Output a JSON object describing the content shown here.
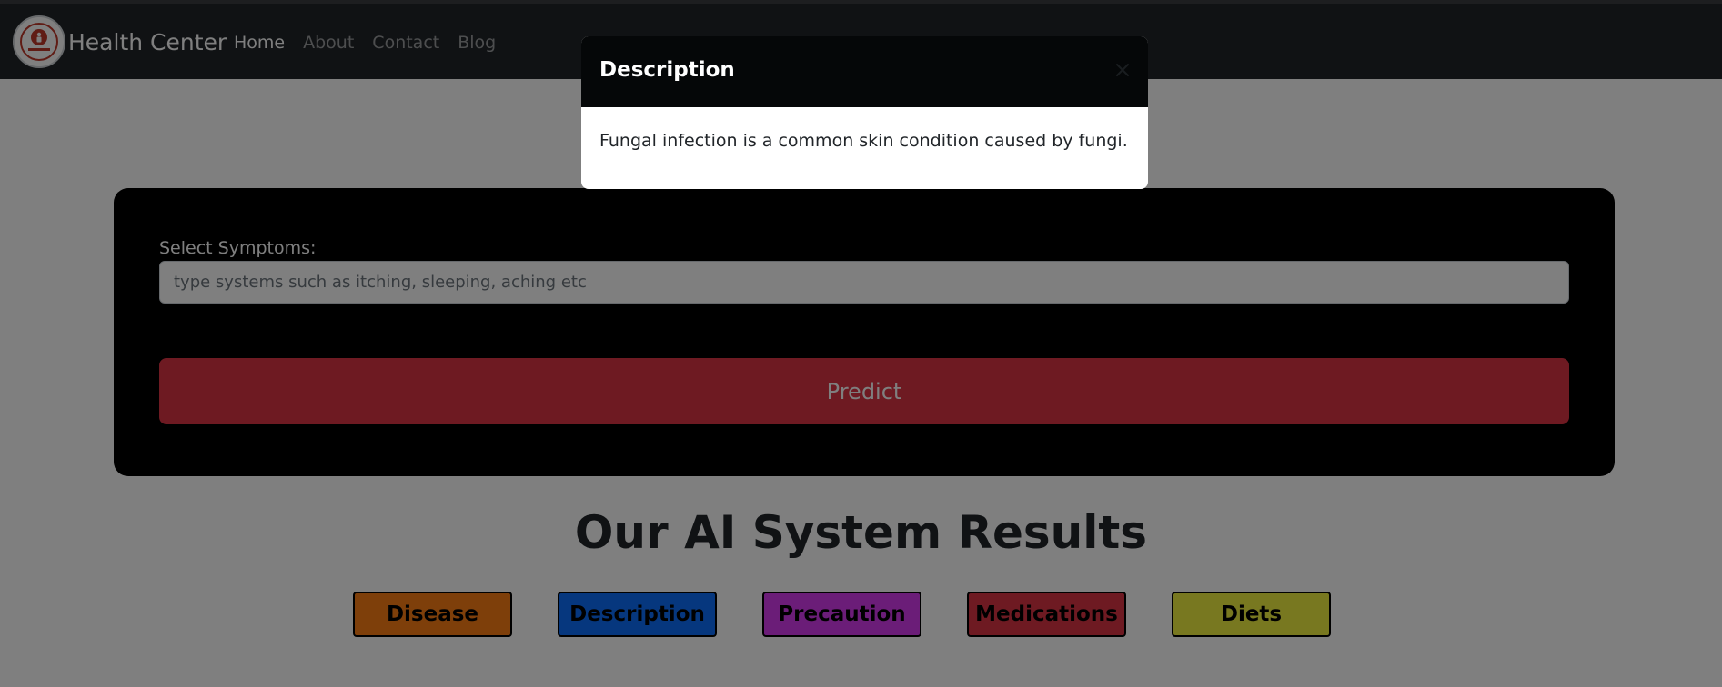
{
  "navbar": {
    "brand": "Health Center",
    "logo_icon": "health-care-logo",
    "links": [
      {
        "label": "Home",
        "active": true
      },
      {
        "label": "About",
        "active": false
      },
      {
        "label": "Contact",
        "active": false
      },
      {
        "label": "Blog",
        "active": false
      }
    ]
  },
  "form": {
    "label": "Select Symptoms:",
    "input_placeholder": "type systems such as itching, sleeping, aching etc",
    "predict_label": "Predict"
  },
  "results": {
    "heading": "Our AI System Results",
    "buttons": [
      {
        "label": "Disease",
        "color": "#fd7e14"
      },
      {
        "label": "Description",
        "color": "#0d6efd"
      },
      {
        "label": "Precaution",
        "color": "#d63af0"
      },
      {
        "label": "Medications",
        "color": "#dc3545"
      },
      {
        "label": "Diets",
        "color": "#f0f040"
      }
    ]
  },
  "modal": {
    "title": "Description",
    "close_icon": "close-icon",
    "body": "Fungal infection is a common skin condition caused by fungi."
  }
}
